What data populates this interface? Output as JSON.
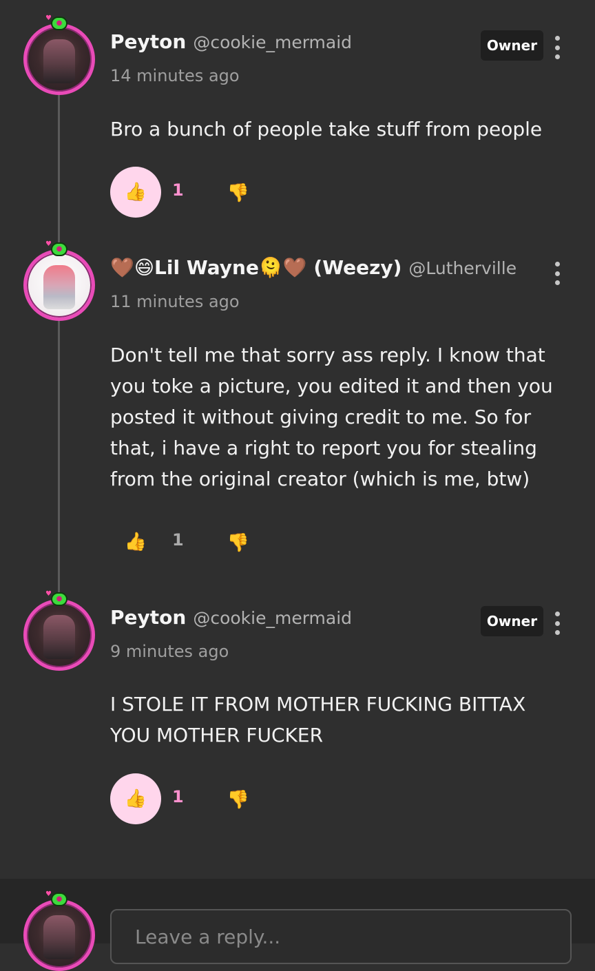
{
  "comments": [
    {
      "name": "Peyton",
      "handle": "@cookie_mermaid",
      "time": "14 minutes ago",
      "badge": "Owner",
      "text": "Bro a bunch of people take stuff from people",
      "likes": "1",
      "liked": true
    },
    {
      "name": "🤎😄Lil Wayne🫠🤎 (Weezy)",
      "handle": "@Lutherville",
      "time": "11 minutes ago",
      "text": "Don't tell me that sorry ass reply. I know that you toke a picture, you edited it and then you posted it without giving credit to me. So for that, i have a right to report you for stealing from the original creator (which is me, btw)",
      "likes": "1",
      "liked": false
    },
    {
      "name": "Peyton",
      "handle": "@cookie_mermaid",
      "time": "9 minutes ago",
      "badge": "Owner",
      "text": "I STOLE IT FROM MOTHER FUCKING BITTAX YOU MOTHER FUCKER",
      "likes": "1",
      "liked": true
    }
  ],
  "reply": {
    "placeholder": "Leave a reply..."
  },
  "icons": {
    "like": "thumbs-up-icon",
    "dislike": "thumbs-down-icon",
    "more": "more-vertical-icon"
  },
  "colors": {
    "accent": "#ffd6ec",
    "count_active": "#ff91ce",
    "avatar_ring": "#e94bb8"
  }
}
